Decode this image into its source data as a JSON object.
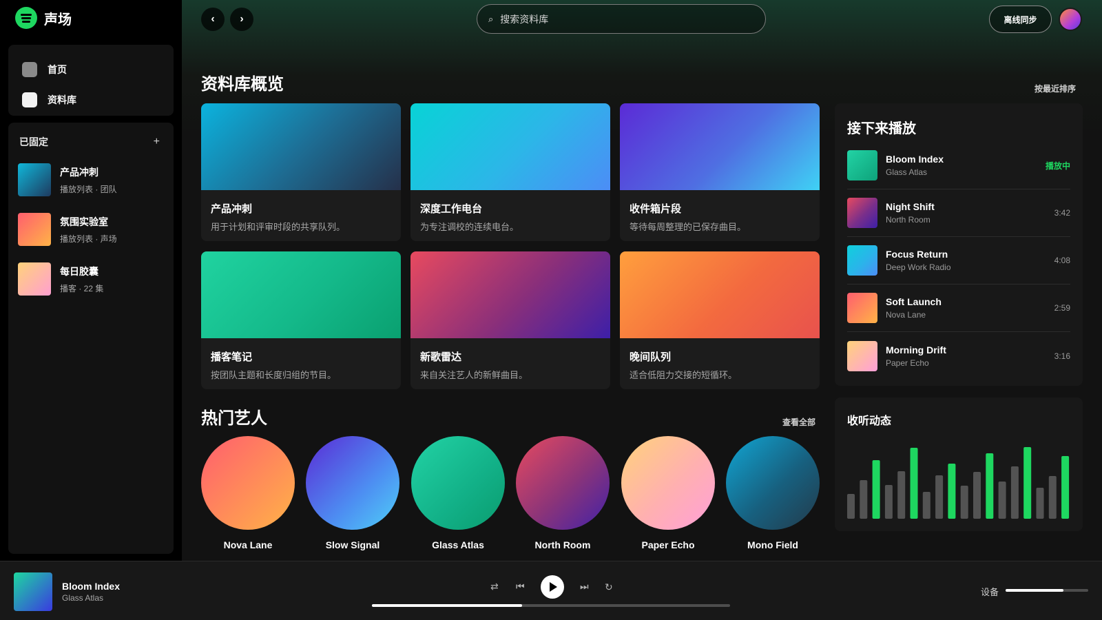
{
  "brand": {
    "name": "声场",
    "color": "#1ed760"
  },
  "nav": [
    {
      "label": "首页",
      "icon": "home-icon"
    },
    {
      "label": "资料库",
      "icon": "library-icon"
    }
  ],
  "pinned": {
    "title": "已固定",
    "add_icon": "+",
    "items": [
      {
        "name": "产品冲刺",
        "sub": "播放列表 · 团队"
      },
      {
        "name": "氛围实验室",
        "sub": "播放列表 · 声场"
      },
      {
        "name": "每日胶囊",
        "sub": "播客 · 22 集"
      }
    ]
  },
  "topbar": {
    "back": "‹",
    "forward": "›",
    "search_placeholder": "搜索资料库",
    "sync_label": "离线同步"
  },
  "overview": {
    "title": "资料库概览",
    "sort_label": "按最近排序",
    "cards": [
      {
        "title": "产品冲刺",
        "desc": "用于计划和评审时段的共享队列。"
      },
      {
        "title": "深度工作电台",
        "desc": "为专注调校的连续电台。"
      },
      {
        "title": "收件箱片段",
        "desc": "等待每周整理的已保存曲目。"
      },
      {
        "title": "播客笔记",
        "desc": "按团队主题和长度归组的节目。"
      },
      {
        "title": "新歌雷达",
        "desc": "来自关注艺人的新鲜曲目。"
      },
      {
        "title": "晚间队列",
        "desc": "适合低阻力交接的短循环。"
      }
    ]
  },
  "artists": {
    "title": "热门艺人",
    "view_all": "查看全部",
    "items": [
      {
        "name": "Nova Lane"
      },
      {
        "name": "Slow Signal"
      },
      {
        "name": "Glass Atlas"
      },
      {
        "name": "North Room"
      },
      {
        "name": "Paper Echo"
      },
      {
        "name": "Mono Field"
      }
    ]
  },
  "queue": {
    "title": "接下来播放",
    "items": [
      {
        "title": "Bloom Index",
        "artist": "Glass Atlas",
        "meta": "播放中",
        "playing": true
      },
      {
        "title": "Night Shift",
        "artist": "North Room",
        "meta": "3:42"
      },
      {
        "title": "Focus Return",
        "artist": "Deep Work Radio",
        "meta": "4:08"
      },
      {
        "title": "Soft Launch",
        "artist": "Nova Lane",
        "meta": "2:59"
      },
      {
        "title": "Morning Drift",
        "artist": "Paper Echo",
        "meta": "3:16"
      }
    ]
  },
  "activity": {
    "title": "收听动态",
    "levels": [
      0.33,
      0.52,
      0.79,
      0.45,
      0.64,
      0.95,
      0.36,
      0.58,
      0.74,
      0.44,
      0.63,
      0.88,
      0.5,
      0.7,
      0.96,
      0.42,
      0.57,
      0.84
    ],
    "highlighted": [
      2,
      5,
      8,
      11,
      14,
      17
    ],
    "accent": "#1ed760",
    "muted": "#535353"
  },
  "player": {
    "title": "Bloom Index",
    "artist": "Glass Atlas",
    "progress": 0.42,
    "device_label": "设备",
    "volume": 0.7,
    "controls": [
      "shuffle-icon",
      "previous-icon",
      "play-icon",
      "next-icon",
      "repeat-icon"
    ]
  }
}
